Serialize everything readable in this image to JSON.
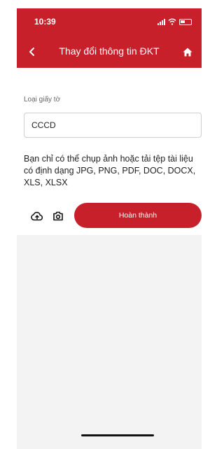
{
  "status_bar": {
    "time": "10:39"
  },
  "header": {
    "title": "Thay đổi thông tin ĐKT"
  },
  "form": {
    "doc_type_label": "Loại giấy tờ",
    "doc_type_value": "CCCD"
  },
  "hint": "Bạn chỉ có thể chụp ảnh hoặc tải tệp tài liệu có định dạng JPG, PNG, PDF, DOC, DOCX, XLS, XLSX",
  "actions": {
    "submit_label": "Hoàn thành"
  },
  "colors": {
    "brand": "#c8202a",
    "background": "#ffffff",
    "panel": "#f3f3f3"
  },
  "icons": [
    "back-arrow-icon",
    "home-icon",
    "upload-cloud-icon",
    "camera-icon"
  ]
}
